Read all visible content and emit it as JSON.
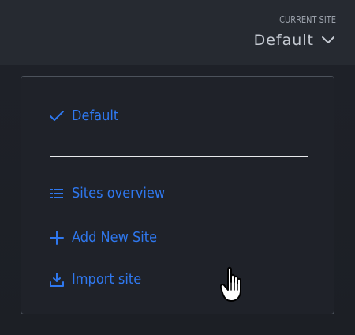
{
  "site_switcher": {
    "caption": "CURRENT SITE",
    "value": "Default",
    "chevron_icon": "chevron-down-icon"
  },
  "dropdown": {
    "items": [
      {
        "label": "Default",
        "icon": "check-icon",
        "selected": true
      },
      {
        "label": "Sites overview",
        "icon": "list-icon"
      },
      {
        "label": "Add New Site",
        "icon": "plus-icon"
      },
      {
        "label": "Import site",
        "icon": "import-icon"
      }
    ]
  },
  "colors": {
    "background": "#1b1e24",
    "panel_background": "#1f2229",
    "panel_border": "#4c525b",
    "accent": "#2f78ef",
    "muted_text": "#9ba1ab",
    "value_text": "#c5cad2",
    "divider": "#e7e9ec"
  },
  "cursor_icon": "hand-pointer-cursor-icon"
}
